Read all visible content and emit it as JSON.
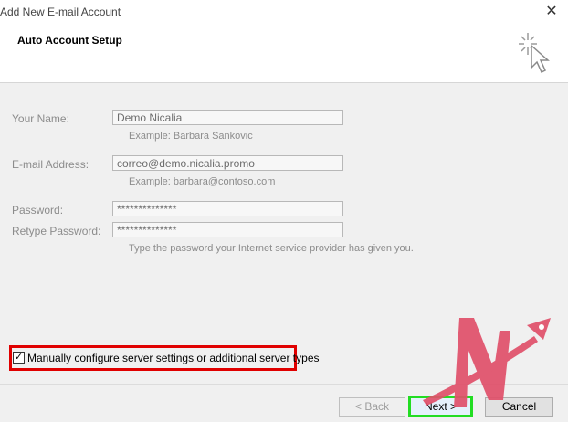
{
  "window": {
    "title": "Add New E-mail Account",
    "close_glyph": "✕"
  },
  "header": {
    "title": "Auto Account Setup",
    "icon": "cursor-sparkle-icon"
  },
  "form": {
    "name": {
      "label": "Your Name:",
      "value": "Demo Nicalia",
      "example": "Example: Barbara Sankovic"
    },
    "email": {
      "label": "E-mail Address:",
      "value": "correo@demo.nicalia.promo",
      "example": "Example: barbara@contoso.com"
    },
    "password": {
      "label": "Password:",
      "value": "**************"
    },
    "retype": {
      "label": "Retype Password:",
      "value": "**************",
      "hint": "Type the password your Internet service provider has given you."
    }
  },
  "manual": {
    "label": "Manually configure server settings or additional server types",
    "checked": true,
    "check_glyph": "✓"
  },
  "buttons": {
    "back": "< Back",
    "next": "Next >",
    "cancel": "Cancel"
  },
  "colors": {
    "highlight_red": "#e00000",
    "highlight_green": "#22dd22",
    "logo_pink": "#e0506a"
  }
}
